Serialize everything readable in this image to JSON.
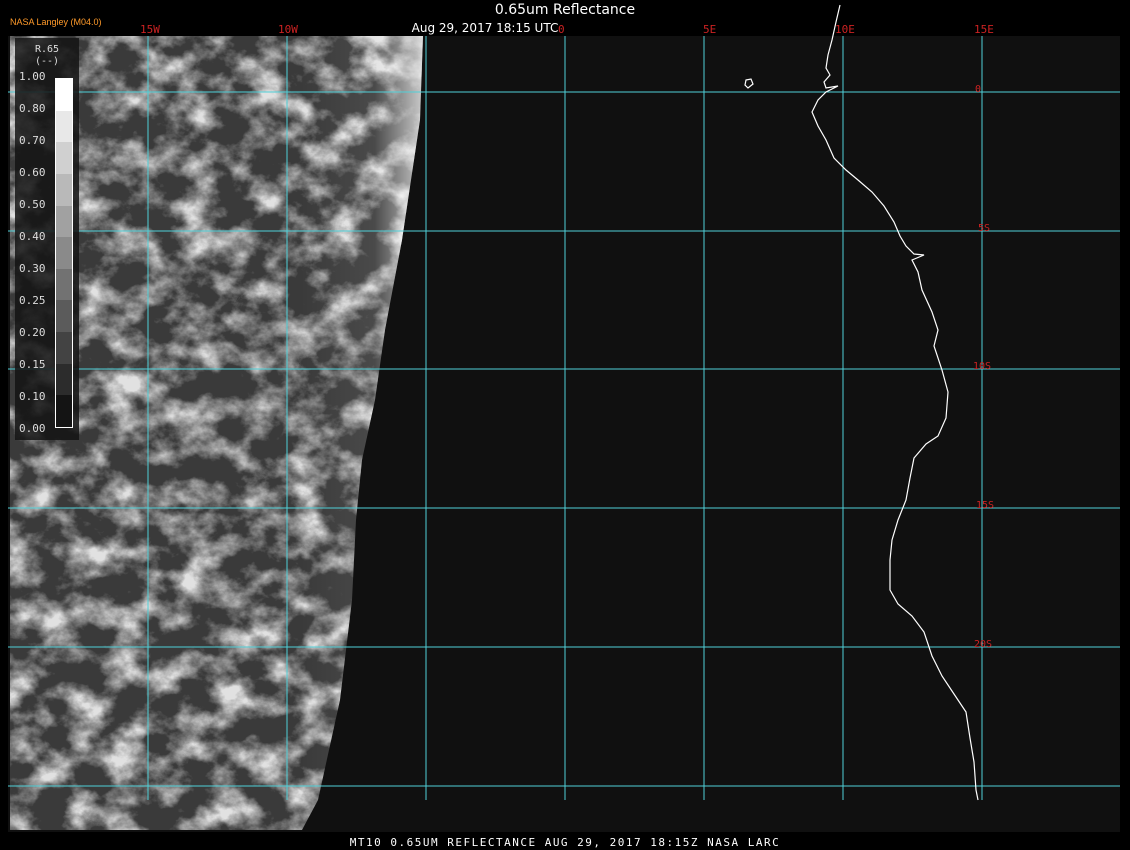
{
  "header": {
    "title": "0.65um Reflectance",
    "timestamp": "Aug 29, 2017 18:15 UTC",
    "brand": "NASA Langley (M04.0)"
  },
  "map": {
    "lon_labels": [
      "15W",
      "10W",
      "0",
      "5E",
      "10E",
      "15E"
    ],
    "lat_labels": [
      "0",
      "5S",
      "10S",
      "15S",
      "20S"
    ],
    "grid_color": "#4fd0d8",
    "label_color": "#cc2222",
    "coast_color": "#ffffff"
  },
  "legend": {
    "title": "R.65",
    "units": "(--)",
    "ticks": [
      "1.00",
      "0.80",
      "0.70",
      "0.60",
      "0.50",
      "0.40",
      "0.30",
      "0.25",
      "0.20",
      "0.15",
      "0.10",
      "0.00"
    ]
  },
  "footer": {
    "text": "MT10  0.65UM REFLECTANCE   AUG 29, 2017 18:15Z   NASA LARC"
  }
}
